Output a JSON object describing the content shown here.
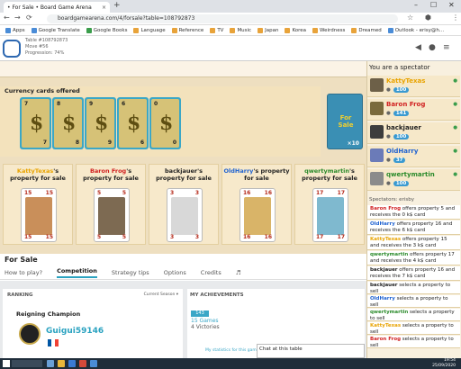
{
  "browser": {
    "tab_title": "• For Sale • Board Game Arena",
    "tab_close": "×",
    "new_tab": "+",
    "url": "boardgamearena.com/4/forsale?table=108792873",
    "bookmarks": [
      {
        "label": "Apps",
        "color": "#4a8cd7"
      },
      {
        "label": "Google Translate",
        "color": "#4a8cd7"
      },
      {
        "label": "Google Books",
        "color": "#3a9d4b"
      },
      {
        "label": "Language",
        "color": "#e8a33a"
      },
      {
        "label": "Reference",
        "color": "#e8a33a"
      },
      {
        "label": "TV",
        "color": "#e8a33a"
      },
      {
        "label": "Music",
        "color": "#e8a33a"
      },
      {
        "label": "Japan",
        "color": "#e8a33a"
      },
      {
        "label": "Korea",
        "color": "#e8a33a"
      },
      {
        "label": "Weirdness",
        "color": "#e8a33a"
      },
      {
        "label": "Dreamed",
        "color": "#e8a33a"
      },
      {
        "label": "Outlook - erisy@h...",
        "color": "#4a8cd7"
      }
    ]
  },
  "header": {
    "table": "Table #108792873",
    "move": "Move #56",
    "progression": "Progression: 74%"
  },
  "board": {
    "title": "Currency cards offered",
    "money_cards": [
      {
        "value": "7"
      },
      {
        "value": "8"
      },
      {
        "value": "9"
      },
      {
        "value": "6"
      },
      {
        "value": "0"
      }
    ],
    "deck_logo": "For Sale",
    "deck_count": "×10"
  },
  "properties": [
    {
      "owner": "KattyTexas",
      "owner_color": "#e8a300",
      "suffix": "'s property for sale",
      "number": "15"
    },
    {
      "owner": "Baron Frog",
      "owner_color": "#d01f1f",
      "suffix": "'s property for sale",
      "number": "5"
    },
    {
      "owner": "backjauer",
      "owner_color": "#222222",
      "suffix": "'s property for sale",
      "number": "3"
    },
    {
      "owner": "OldHarry",
      "owner_color": "#1f62d0",
      "suffix": "'s property for sale",
      "number": "16"
    },
    {
      "owner": "qwertymartin",
      "owner_color": "#2a8a2a",
      "suffix": "'s property for sale",
      "number": "17"
    }
  ],
  "sidebar": {
    "spectator_text": "You are a spectator",
    "players": [
      {
        "name": "KattyTexas",
        "color": "#e8a300",
        "score": "100",
        "avatar": "#6d6048"
      },
      {
        "name": "Baron Frog",
        "color": "#d01f1f",
        "score": "141",
        "avatar": "#7a6a3d"
      },
      {
        "name": "backjauer",
        "color": "#222222",
        "score": "100",
        "avatar": "#3d3d3d"
      },
      {
        "name": "OldHarry",
        "color": "#1f62d0",
        "score": "37",
        "avatar": "#6b7bb8"
      },
      {
        "name": "qwertymartin",
        "color": "#2a8a2a",
        "score": "100",
        "avatar": "#8b8b8b"
      }
    ],
    "spectators_label": "Spectators:",
    "spectators_value": "erisby",
    "log": [
      {
        "who": "Baron Frog",
        "color": "#d01f1f",
        "text": " offers property 5 and receives the 0 k$ card"
      },
      {
        "who": "OldHarry",
        "color": "#1f62d0",
        "text": " offers property 16 and receives the 6 k$ card"
      },
      {
        "who": "KattyTexas",
        "color": "#e8a300",
        "text": " offers property 15 and receives the 3 k$ card"
      },
      {
        "who": "qwertymartin",
        "color": "#2a8a2a",
        "text": " offers property 17 and receives the 4 k$ card"
      },
      {
        "who": "backjauer",
        "color": "#222222",
        "text": " offers property 16 and receives the 7 k$ card"
      },
      {
        "who": "backjauer",
        "color": "#222222",
        "text": " selects a property to sell"
      },
      {
        "who": "OldHarry",
        "color": "#1f62d0",
        "text": " selects a property to sell"
      },
      {
        "who": "qwertymartin",
        "color": "#2a8a2a",
        "text": " selects a property to sell"
      },
      {
        "who": "KattyTexas",
        "color": "#e8a300",
        "text": " selects a property to sell"
      },
      {
        "who": "Baron Frog",
        "color": "#d01f1f",
        "text": " selects a property to sell"
      }
    ]
  },
  "page": {
    "section_title": "For Sale",
    "tabs": [
      "How to play?",
      "Competition",
      "Strategy tips",
      "Options",
      "Credits",
      "♬"
    ],
    "active_tab": "Competition"
  },
  "ranking": {
    "heading": "RANKING",
    "season": "Current Season ▾",
    "reigning": "Reigning Champion",
    "champion": "Guigui59146"
  },
  "achievements": {
    "heading": "MY ACHIEVEMENTS",
    "badge": "143",
    "games": "15 Games",
    "victories": "4 Victories",
    "stats_link": "My statistics for this game"
  },
  "chat": {
    "label": "Chat at this table"
  },
  "taskbar": {
    "time": "19:54",
    "date": "25/09/2020"
  }
}
